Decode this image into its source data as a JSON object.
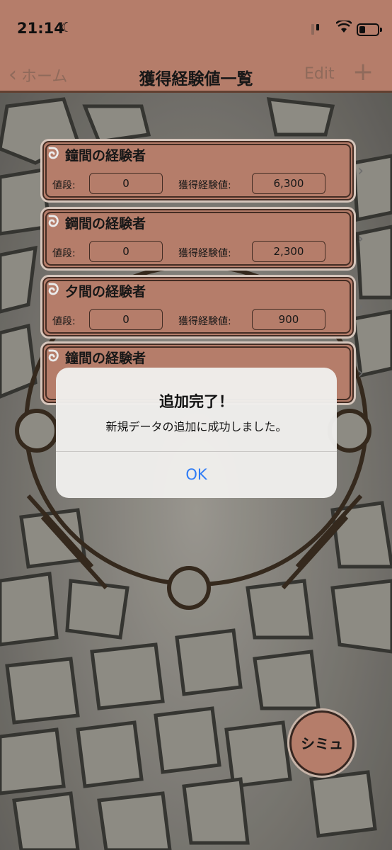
{
  "status_bar": {
    "time": "21:14"
  },
  "nav": {
    "back_label": "ホーム",
    "title": "獲得経験値一覧",
    "edit_label": "Edit",
    "add_symbol": "+"
  },
  "list": {
    "price_label": "値段:",
    "exp_label": "獲得経験値:",
    "items": [
      {
        "title": "鐘間の経験者",
        "price": "0",
        "exp": "6,300"
      },
      {
        "title": "鋼間の経験者",
        "price": "0",
        "exp": "2,300"
      },
      {
        "title": "夕間の経験者",
        "price": "0",
        "exp": "900"
      },
      {
        "title": "鐘間の経験者",
        "price": "",
        "exp": ""
      }
    ]
  },
  "alert": {
    "title": "追加完了！",
    "message": "新規データの追加に成功しました。",
    "ok_label": "OK"
  },
  "fab": {
    "label": "シミュ"
  },
  "colors": {
    "accent": "#c58873",
    "alert_button": "#2f7cf6"
  }
}
